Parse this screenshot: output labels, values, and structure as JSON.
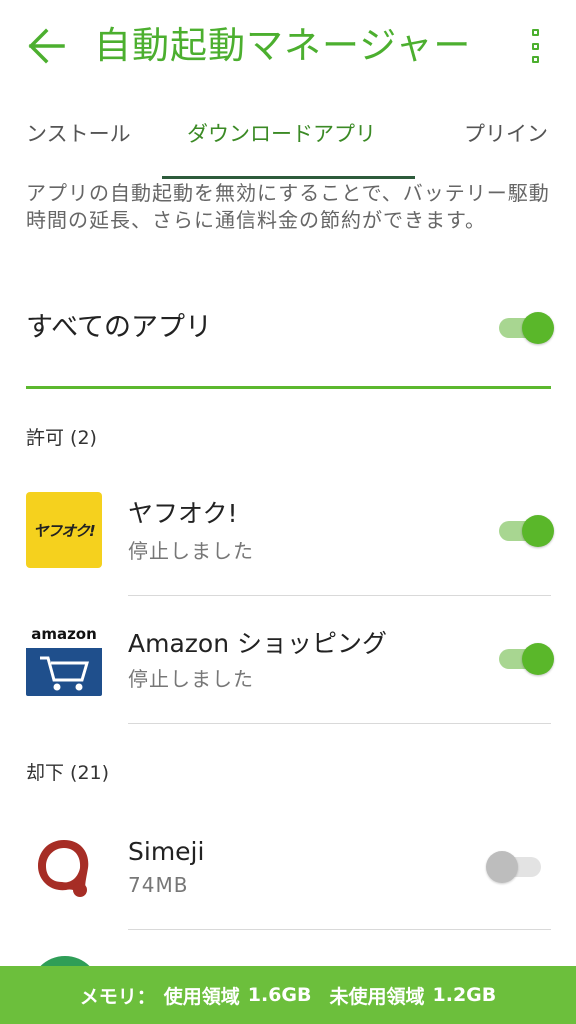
{
  "header": {
    "title": "自動起動マネージャー",
    "back_icon": "arrow-left-icon",
    "more_icon": "more-vertical-icon"
  },
  "tabs": [
    {
      "label": "ンストール"
    },
    {
      "label": "ダウンロードアプリ"
    },
    {
      "label": "プリイン"
    }
  ],
  "description": "アプリの自動起動を無効にすることで、バッテリー駆動時間の延長、さらに通信料金の節約ができます。",
  "all_apps": {
    "label": "すべてのアプリ",
    "enabled": true
  },
  "allowed": {
    "header": "許可 (2)",
    "apps": [
      {
        "name": "ヤフオク!",
        "status": "停止しました",
        "enabled": true,
        "icon_text": "ヤフオク!"
      },
      {
        "name": "Amazon ショッピング",
        "status": "停止しました",
        "enabled": true,
        "icon_text": "amazon"
      }
    ]
  },
  "denied": {
    "header": "却下 (21)",
    "apps": [
      {
        "name": "Simeji",
        "status": "74MB",
        "enabled": false
      }
    ]
  },
  "memory_bar": {
    "label": "メモリ：",
    "used_label": "使用領域",
    "used_value": "1.6GB",
    "free_label": "未使用領域",
    "free_value": "1.2GB"
  },
  "colors": {
    "accent": "#4caf2f",
    "toggle_on": "#5ab72a",
    "bottom_bar": "#6cbf3c",
    "tab_indicator": "#2d5b3b",
    "yahuoku_bg": "#f5d11e",
    "amazon_bg": "#1f4f8c"
  }
}
